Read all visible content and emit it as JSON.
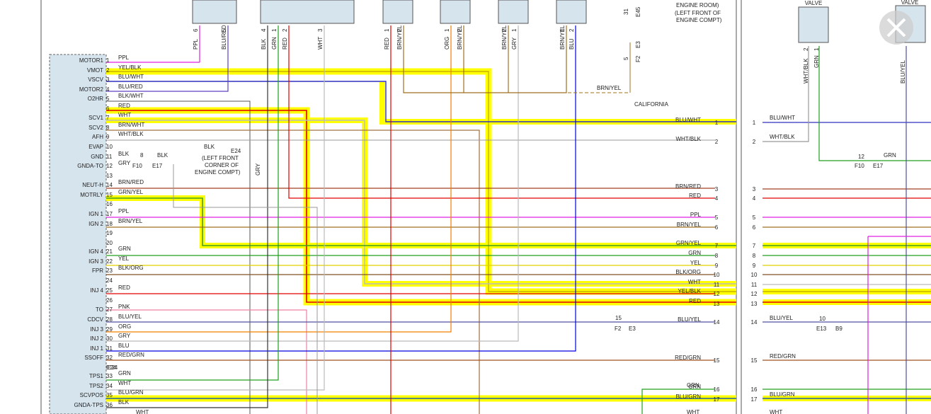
{
  "colors": {
    "highlight": "#ffff00",
    "connector_fill": "#d6e4ee",
    "frame": "#555555"
  },
  "ecm_pins": [
    {
      "n": "1",
      "label": "MOTOR1",
      "wire": "PPL",
      "color": "#e020e0"
    },
    {
      "n": "2",
      "label": "VMOT",
      "wire": "YEL/BLK",
      "color": "#c8b000"
    },
    {
      "n": "3",
      "label": "VSCV",
      "wire": "BLU/WHT",
      "color": "#3030c0"
    },
    {
      "n": "4",
      "label": "MOTOR2",
      "wire": "BLU/RED",
      "color": "#6040c0"
    },
    {
      "n": "5",
      "label": "O2HR",
      "wire": "BLK/WHT",
      "color": "#555555"
    },
    {
      "n": "6",
      "label": "",
      "wire": "RED",
      "color": "#e00000"
    },
    {
      "n": "7",
      "label": "SCV1",
      "wire": "WHT",
      "color": "#bbbbbb"
    },
    {
      "n": "8",
      "label": "SCV2",
      "wire": "BRN/WHT",
      "color": "#a07040"
    },
    {
      "n": "9",
      "label": "AFH",
      "wire": "WHT/BLK",
      "color": "#999999"
    },
    {
      "n": "10",
      "label": "EVAP",
      "wire": "",
      "color": ""
    },
    {
      "n": "11",
      "label": "GND",
      "wire": "BLK",
      "color": "#333333"
    },
    {
      "n": "12",
      "label": "GNDA-TO",
      "wire": "GRY",
      "color": "#999999"
    },
    {
      "n": "13",
      "label": "",
      "wire": "",
      "color": ""
    },
    {
      "n": "14",
      "label": "NEUT-H",
      "wire": "BRN/RED",
      "color": "#a04020"
    },
    {
      "n": "15",
      "label": "MOTRLY",
      "wire": "GRN/YEL",
      "color": "#60a020"
    },
    {
      "n": "16",
      "label": "",
      "wire": "",
      "color": ""
    },
    {
      "n": "17",
      "label": "IGN 1",
      "wire": "PPL",
      "color": "#e020e0"
    },
    {
      "n": "18",
      "label": "IGN 2",
      "wire": "BRN/YEL",
      "color": "#a07020"
    },
    {
      "n": "19",
      "label": "",
      "wire": "",
      "color": ""
    },
    {
      "n": "20",
      "label": "",
      "wire": "",
      "color": ""
    },
    {
      "n": "21",
      "label": "IGN 4",
      "wire": "GRN",
      "color": "#20a020"
    },
    {
      "n": "22",
      "label": "IGN 3",
      "wire": "YEL",
      "color": "#e0d000"
    },
    {
      "n": "23",
      "label": "FPR",
      "wire": "BLK/ORG",
      "color": "#805020"
    },
    {
      "n": "24",
      "label": "",
      "wire": "",
      "color": ""
    },
    {
      "n": "25",
      "label": "INJ 4",
      "wire": "RED",
      "color": "#e00000"
    },
    {
      "n": "26",
      "label": "",
      "wire": "",
      "color": ""
    },
    {
      "n": "27",
      "label": "TO",
      "wire": "PNK",
      "color": "#f080a0"
    },
    {
      "n": "28",
      "label": "CDCV",
      "wire": "BLU/YEL",
      "color": "#5050a0"
    },
    {
      "n": "29",
      "label": "INJ 3",
      "wire": "ORG",
      "color": "#f08000"
    },
    {
      "n": "30",
      "label": "INJ 2",
      "wire": "GRY",
      "color": "#999999"
    },
    {
      "n": "31",
      "label": "INJ 1",
      "wire": "BLU",
      "color": "#0000e0"
    },
    {
      "n": "32",
      "label": "SSOFF",
      "wire": "RED/GRN",
      "color": "#a05020"
    },
    {
      "n": "E24",
      "label": "",
      "wire": "",
      "color": ""
    },
    {
      "n": "33",
      "label": "TPS1",
      "wire": "GRN",
      "color": "#20a020"
    },
    {
      "n": "34",
      "label": "TPS2",
      "wire": "WHT",
      "color": "#bbbbbb"
    },
    {
      "n": "35",
      "label": "SCVPOS",
      "wire": "BLU/GRN",
      "color": "#2060a0"
    },
    {
      "n": "36",
      "label": "GNDA-TPS",
      "wire": "BLK",
      "color": "#333333"
    }
  ],
  "right_pins": [
    {
      "n": "1",
      "wire": "BLU/WHT"
    },
    {
      "n": "2",
      "wire": "WHT/BLK"
    },
    {
      "n": "3",
      "wire": "BRN/RED"
    },
    {
      "n": "4",
      "wire": "RED"
    },
    {
      "n": "5",
      "wire": "PPL"
    },
    {
      "n": "6",
      "wire": "BRN/YEL"
    },
    {
      "n": "7",
      "wire": "GRN/YEL"
    },
    {
      "n": "8",
      "wire": "GRN"
    },
    {
      "n": "9",
      "wire": "YEL"
    },
    {
      "n": "10",
      "wire": "BLK/ORG"
    },
    {
      "n": "11",
      "wire": "WHT"
    },
    {
      "n": "12",
      "wire": "YEL/BLK"
    },
    {
      "n": "13",
      "wire": "RED"
    },
    {
      "n": "14",
      "wire": "BLU/YEL"
    },
    {
      "n": "15",
      "wire": "RED/GRN"
    },
    {
      "n": "16",
      "wire": "GRN"
    },
    {
      "n": "17",
      "wire": "BLU/GRN"
    }
  ],
  "top_wires": [
    {
      "n": "6",
      "wire": "PPL"
    },
    {
      "n": "5",
      "wire": "BLU/RED"
    },
    {
      "n": "4",
      "wire": "BLK"
    },
    {
      "n": "1",
      "wire": "GRN"
    },
    {
      "n": "2",
      "wire": "RED"
    },
    {
      "n": "3",
      "wire": "WHT"
    },
    {
      "n": "1",
      "wire": "RED"
    },
    {
      "n": "2",
      "wire": "BRN/YEL"
    },
    {
      "n": "1",
      "wire": "ORG"
    },
    {
      "n": "2",
      "wire": "BRN/YEL"
    },
    {
      "n": "2",
      "wire": "BRN/YEL"
    },
    {
      "n": "1",
      "wire": "GRY"
    },
    {
      "n": "1",
      "wire": "BRN/YEL"
    },
    {
      "n": "2",
      "wire": "BLU"
    }
  ],
  "labels": {
    "california": "CALIFORNIA",
    "brn_yel_bus": "BRN/YEL",
    "engine_room": "ENGINE ROOM)",
    "left_front": "(LEFT FRONT OF",
    "engine_compt": "ENGINE COMPT)",
    "e45": "E45",
    "e3": "E3",
    "f2": "F2",
    "pin31": "31",
    "pin5": "5",
    "blk_gnd": "BLK",
    "e24": "E24",
    "gnd_note1": "(LEFT FRONT",
    "gnd_note2": "CORNER OF",
    "gnd_note3": "ENGINE COMPT)",
    "pin8": "8",
    "blk_short": "BLK",
    "f10": "F10",
    "e17": "E17",
    "gry_short": "GRY",
    "gry_vert": "GRY",
    "e24_pin": "E24",
    "pin15_conn": "15",
    "f2_b": "F2",
    "e3_b": "E3",
    "valve": "VALVE",
    "valve2": "VALVE",
    "whtblk_v": "WHT/BLK",
    "grn_v": "GRN",
    "bluyel_v": "BLU/YEL",
    "pin2": "2",
    "pin1": "1",
    "pin12": "12",
    "grn_r": "GRN",
    "f10_r": "F10",
    "e17_r": "E17",
    "pin10": "10",
    "e13": "E13",
    "b9": "B9",
    "whtblk_r": "WHT/BLK",
    "bluwht_r": "BLU/WHT",
    "bluyel_r": "BLU/YEL",
    "redgrn_r": "RED/GRN",
    "blugrn_r": "BLU/GRN",
    "grn_r16": "GRN",
    "wht_bottom": "WHT",
    "wht_bottom2": "WHT",
    "wht_bottom3": "WHT"
  }
}
